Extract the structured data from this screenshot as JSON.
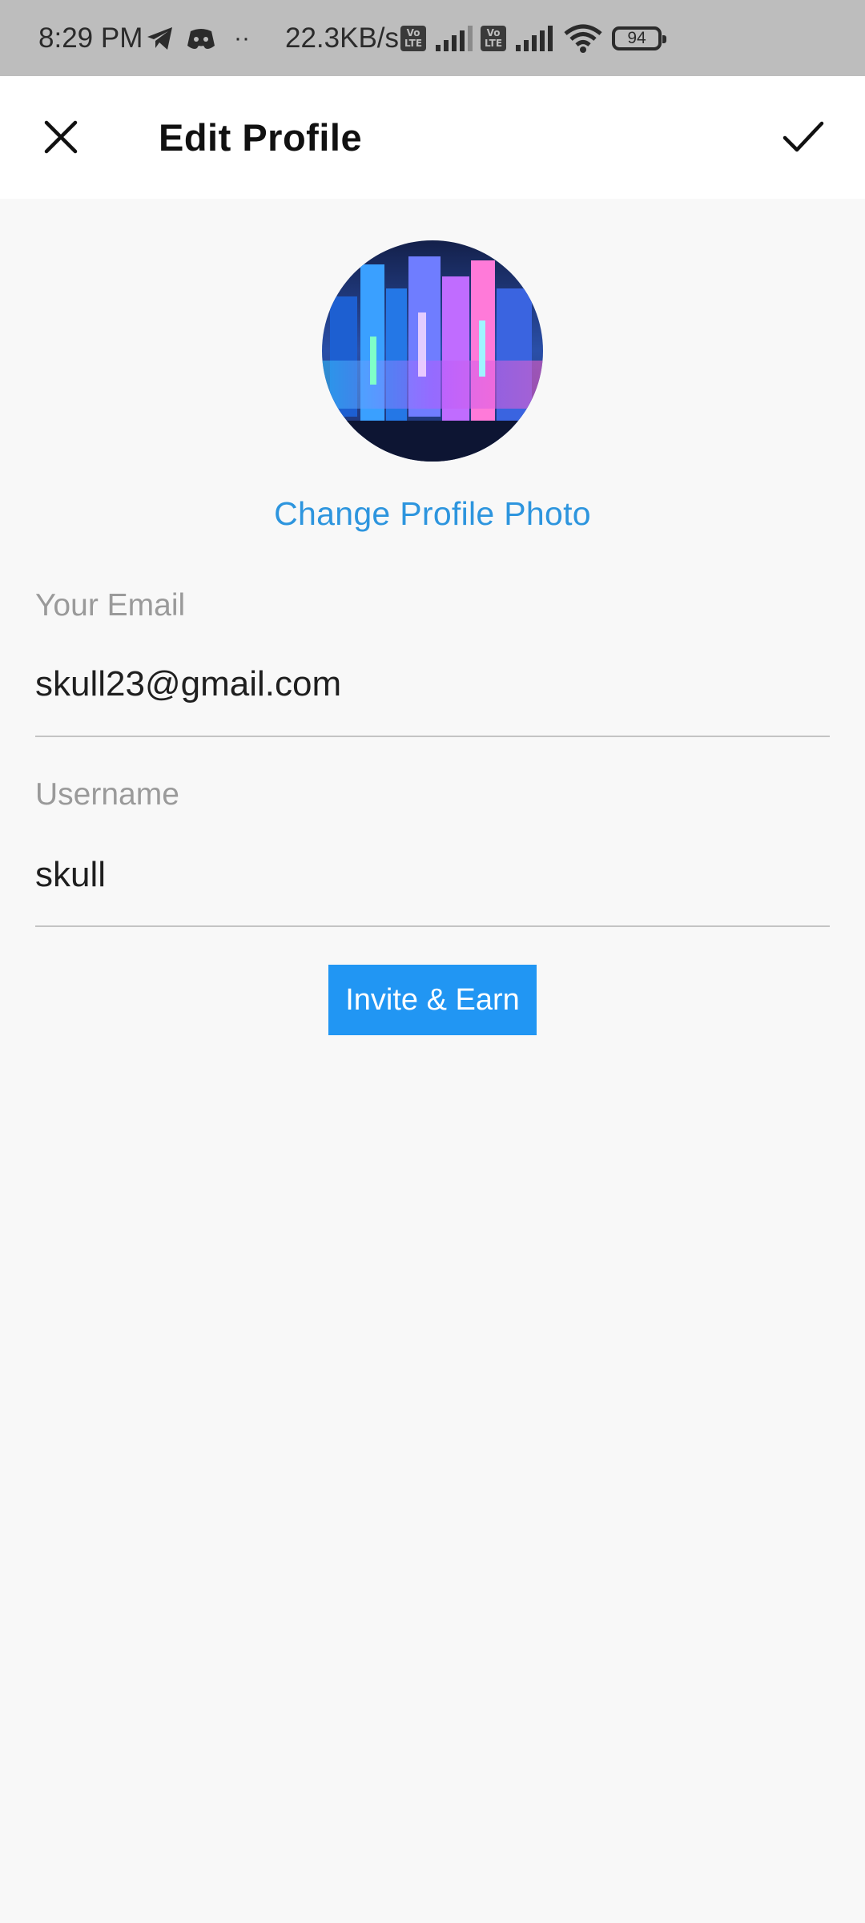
{
  "status_bar": {
    "time": "8:29 PM",
    "dots": "··",
    "network_speed": "22.3KB/s",
    "volte_top": "Vo",
    "volte_bottom": "LTE",
    "battery": "94",
    "icons": [
      "telegram-icon",
      "discord-icon",
      "volte-icon",
      "signal-icon",
      "wifi-icon",
      "battery-icon"
    ]
  },
  "app_bar": {
    "title": "Edit Profile",
    "close_icon": "close-icon",
    "save_icon": "check-icon"
  },
  "profile": {
    "change_photo_label": "Change Profile Photo"
  },
  "form": {
    "email_label": "Your Email",
    "email_value": "skull23@gmail.com",
    "username_label": "Username",
    "username_value": "skull"
  },
  "actions": {
    "invite_label": "Invite & Earn"
  },
  "colors": {
    "accent": "#2196f3",
    "link": "#2d95de",
    "status_bar_bg": "#bdbdbd",
    "page_bg": "#f8f8f8"
  }
}
